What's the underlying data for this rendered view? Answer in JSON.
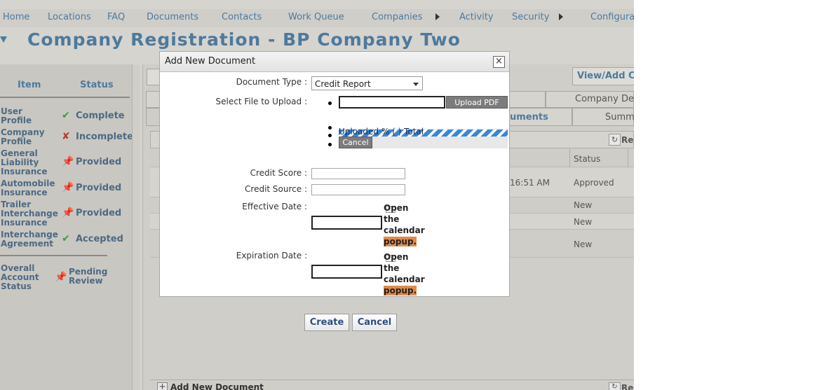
{
  "nav": {
    "items": [
      "Home",
      "Locations",
      "FAQ",
      "Documents",
      "Contacts",
      "Work Queue",
      "Companies",
      "Activity",
      "Security",
      "Configurati"
    ]
  },
  "page": {
    "title": "Company Registration - BP Company Two"
  },
  "status_panel": {
    "col_item": "Item",
    "col_status": "Status",
    "rows": [
      {
        "item_lines": [
          "User",
          "Profile"
        ],
        "status": "Complete",
        "icon": "check-icon"
      },
      {
        "item_lines": [
          "Company",
          "Profile"
        ],
        "status": "Incomplete",
        "icon": "x-icon"
      },
      {
        "item_lines": [
          "General",
          "Liability",
          "Insurance"
        ],
        "status": "Provided",
        "icon": "pin-icon"
      },
      {
        "item_lines": [
          "Automobile",
          "Insurance"
        ],
        "status": "Provided",
        "icon": "pin-icon"
      },
      {
        "item_lines": [
          "Trailer",
          "Interchange",
          "Insurance"
        ],
        "status": "Provided",
        "icon": "pin-icon"
      },
      {
        "item_lines": [
          "Interchange",
          "Agreement"
        ],
        "status": "Accepted",
        "icon": "check-icon"
      }
    ],
    "overall": {
      "item_lines": [
        "Overall",
        "Account",
        "Status"
      ],
      "status_lines": [
        "Pending",
        "Review"
      ],
      "icon": "pin-icon"
    }
  },
  "right_panel": {
    "view_add_btn": "View/Add Co",
    "tab_company_det": "Company Det",
    "tab_documents": "uments",
    "tab_summary": "Summa",
    "refresh_label": "Re",
    "col_status": "Status",
    "rows": [
      {
        "time": "16:51 AM",
        "status": "Approved"
      },
      {
        "time": "",
        "status": "New"
      },
      {
        "time": "",
        "status": "New"
      },
      {
        "time": "",
        "status": "New"
      }
    ],
    "bottom_add": "Add New Document",
    "bottom_refresh": "Re"
  },
  "modal": {
    "title": "Add New Document",
    "close_glyph": "×",
    "doc_type_label": "Document Type :",
    "doc_type_value": "Credit Report",
    "file_label": "Select File to Upload :",
    "upload_btn": "Upload PDF",
    "progress_text": "Uploaded % ( ) Total",
    "upload_cancel": "Cancel",
    "credit_score_label": "Credit Score :",
    "credit_source_label": "Credit Source :",
    "effective_date_label": "Effective Date  :",
    "expiration_date_label": "Expiration Date  :",
    "calendar_text_lines": [
      "Open",
      "the",
      "calendar",
      "popup."
    ]
  },
  "footer": {
    "create_btn": "Create",
    "cancel_btn": "Cancel"
  }
}
